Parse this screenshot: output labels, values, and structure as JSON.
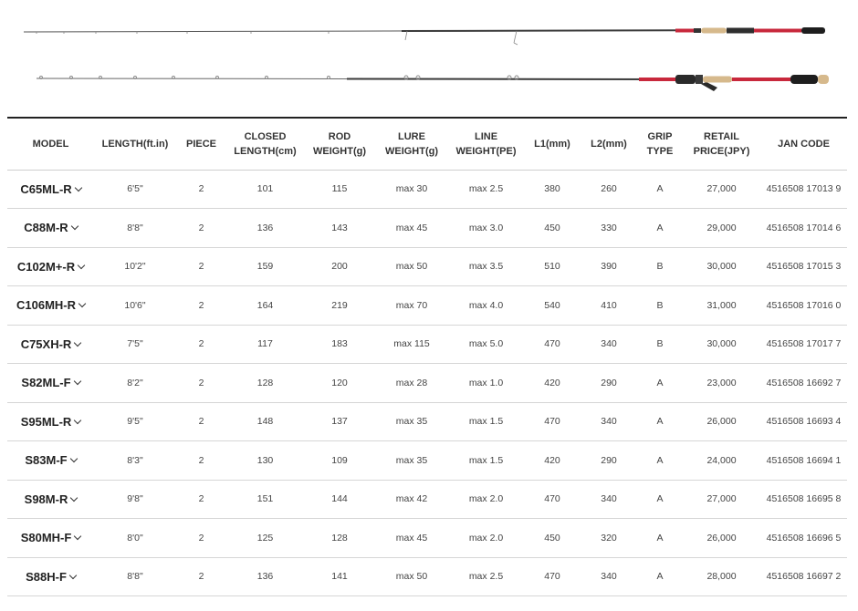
{
  "images": {
    "rod_1_icon": "spinning-rod-icon",
    "rod_2_icon": "baitcasting-rod-icon",
    "accent_color": "#c8283c",
    "cork_color": "#d6b98c"
  },
  "table": {
    "headers": {
      "model": "MODEL",
      "length": "LENGTH(ft.in)",
      "piece": "PIECE",
      "closed_length": "CLOSED\nLENGTH(cm)",
      "rod_weight": "ROD\nWEIGHT(g)",
      "lure_weight": "LURE\nWEIGHT(g)",
      "line_weight": "LINE\nWEIGHT(PE)",
      "l1": "L1(mm)",
      "l2": "L2(mm)",
      "grip_type": "GRIP\nTYPE",
      "retail_price": "RETAIL\nPRICE(JPY)",
      "jan_code": "JAN CODE"
    },
    "rows": [
      {
        "model": "C65ML-R",
        "length": "6'5\"",
        "piece": "2",
        "closed": "101",
        "rod_weight": "115",
        "lure": "max 30",
        "line": "max 2.5",
        "l1": "380",
        "l2": "260",
        "grip": "A",
        "price": "27,000",
        "jan": "4516508 17013 9"
      },
      {
        "model": "C88M-R",
        "length": "8'8\"",
        "piece": "2",
        "closed": "136",
        "rod_weight": "143",
        "lure": "max 45",
        "line": "max 3.0",
        "l1": "450",
        "l2": "330",
        "grip": "A",
        "price": "29,000",
        "jan": "4516508 17014 6"
      },
      {
        "model": "C102M+-R",
        "length": "10'2\"",
        "piece": "2",
        "closed": "159",
        "rod_weight": "200",
        "lure": "max 50",
        "line": "max 3.5",
        "l1": "510",
        "l2": "390",
        "grip": "B",
        "price": "30,000",
        "jan": "4516508 17015 3"
      },
      {
        "model": "C106MH-R",
        "length": "10'6\"",
        "piece": "2",
        "closed": "164",
        "rod_weight": "219",
        "lure": "max 70",
        "line": "max 4.0",
        "l1": "540",
        "l2": "410",
        "grip": "B",
        "price": "31,000",
        "jan": "4516508 17016 0"
      },
      {
        "model": "C75XH-R",
        "length": "7'5\"",
        "piece": "2",
        "closed": "117",
        "rod_weight": "183",
        "lure": "max 115",
        "line": "max 5.0",
        "l1": "470",
        "l2": "340",
        "grip": "B",
        "price": "30,000",
        "jan": "4516508 17017 7"
      },
      {
        "model": "S82ML-F",
        "length": "8'2\"",
        "piece": "2",
        "closed": "128",
        "rod_weight": "120",
        "lure": "max 28",
        "line": "max 1.0",
        "l1": "420",
        "l2": "290",
        "grip": "A",
        "price": "23,000",
        "jan": "4516508 16692 7"
      },
      {
        "model": "S95ML-R",
        "length": "9'5\"",
        "piece": "2",
        "closed": "148",
        "rod_weight": "137",
        "lure": "max 35",
        "line": "max 1.5",
        "l1": "470",
        "l2": "340",
        "grip": "A",
        "price": "26,000",
        "jan": "4516508 16693 4"
      },
      {
        "model": "S83M-F",
        "length": "8'3\"",
        "piece": "2",
        "closed": "130",
        "rod_weight": "109",
        "lure": "max 35",
        "line": "max 1.5",
        "l1": "420",
        "l2": "290",
        "grip": "A",
        "price": "24,000",
        "jan": "4516508 16694 1"
      },
      {
        "model": "S98M-R",
        "length": "9'8\"",
        "piece": "2",
        "closed": "151",
        "rod_weight": "144",
        "lure": "max 42",
        "line": "max 2.0",
        "l1": "470",
        "l2": "340",
        "grip": "A",
        "price": "27,000",
        "jan": "4516508 16695 8"
      },
      {
        "model": "S80MH-F",
        "length": "8'0\"",
        "piece": "2",
        "closed": "125",
        "rod_weight": "128",
        "lure": "max 45",
        "line": "max 2.0",
        "l1": "450",
        "l2": "320",
        "grip": "A",
        "price": "26,000",
        "jan": "4516508 16696 5"
      },
      {
        "model": "S88H-F",
        "length": "8'8\"",
        "piece": "2",
        "closed": "136",
        "rod_weight": "141",
        "lure": "max 50",
        "line": "max 2.5",
        "l1": "470",
        "l2": "340",
        "grip": "A",
        "price": "28,000",
        "jan": "4516508 16697 2"
      }
    ]
  }
}
